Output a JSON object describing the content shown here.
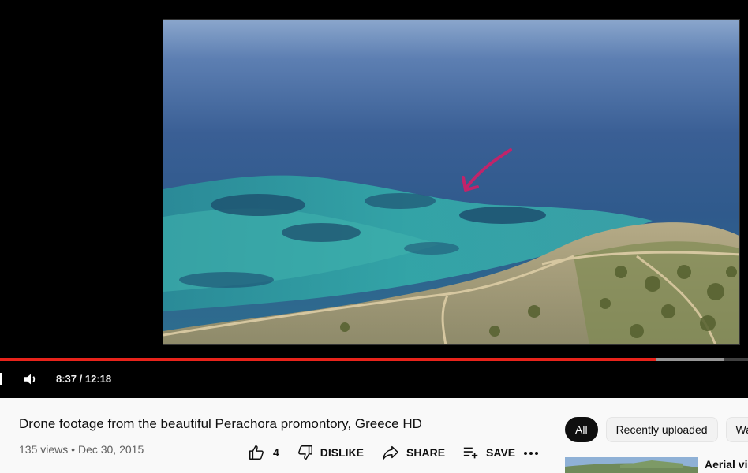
{
  "player": {
    "time_current": "8:37",
    "time_separator": " / ",
    "time_total": "12:18",
    "progress_fraction": 0.878,
    "buffer_fraction": 0.968,
    "accent_color": "#e8231b"
  },
  "video": {
    "title": "Drone footage from the beautiful Perachora promontory, Greece HD",
    "views": "135 views",
    "meta_separator": " • ",
    "date": "Dec 30, 2015"
  },
  "actions": {
    "like_count": "4",
    "dislike_label": "DISLIKE",
    "share_label": "SHARE",
    "save_label": "SAVE"
  },
  "icons": {
    "volume": "volume-icon",
    "like": "thumbs-up-icon",
    "dislike": "thumbs-down-icon",
    "share": "share-arrow-icon",
    "save": "playlist-add-icon",
    "more": "more-horizontal-icon"
  },
  "chips": [
    {
      "label": "All",
      "active": true
    },
    {
      "label": "Recently uploaded",
      "active": false
    },
    {
      "label": "Wa",
      "active": false
    }
  ],
  "related": {
    "title": "Aerial vie"
  }
}
